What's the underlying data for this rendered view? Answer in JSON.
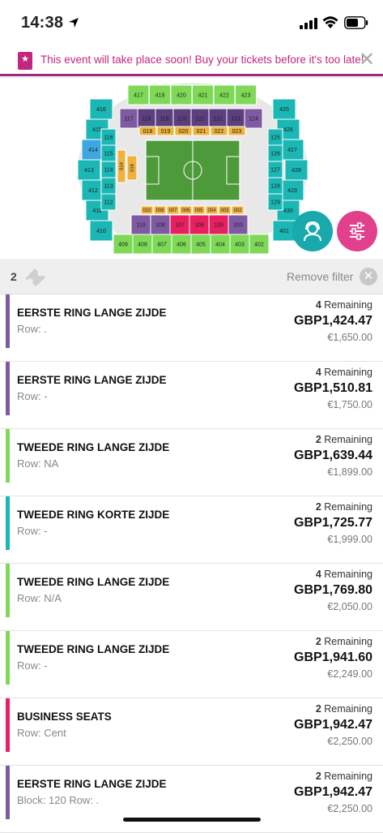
{
  "status": {
    "time": "14:38"
  },
  "banner": {
    "message": "This event will take place soon! Buy your tickets before it's too late!",
    "close": "✕"
  },
  "stadium": {
    "colors": {
      "purple": "#7e5aa3",
      "teal": "#1ab7b4",
      "green": "#7ed957",
      "blue": "#3ea6e0",
      "orange": "#f0b23e",
      "red": "#e8205f",
      "pitch": "#4d9a3a"
    },
    "labels": {
      "top_outer": [
        "417",
        "419",
        "420",
        "421",
        "422",
        "423"
      ],
      "top_inner": [
        "117",
        "118",
        "119",
        "120",
        "121",
        "122",
        "123",
        "124"
      ],
      "top_lower": [
        "018",
        "019",
        "020",
        "021",
        "022",
        "023"
      ],
      "bottom_lower": [
        "010",
        "008",
        "007",
        "006",
        "005",
        "004",
        "003",
        "002"
      ],
      "bottom_inner": [
        "110",
        "108",
        "107",
        "106",
        "105",
        "103"
      ],
      "bottom_outer": [
        "409",
        "408",
        "407",
        "406",
        "405",
        "404",
        "403",
        "402"
      ],
      "left": [
        "416",
        "415",
        "414",
        "413",
        "412",
        "411",
        "410",
        "116",
        "115",
        "114",
        "113",
        "112"
      ],
      "right": [
        "425",
        "426",
        "427",
        "428",
        "429",
        "430",
        "401",
        "125",
        "126",
        "127",
        "128",
        "129"
      ],
      "mid_left": [
        "014",
        "016"
      ]
    }
  },
  "filter": {
    "count": "2",
    "remove_label": "Remove filter",
    "remove_icon": "✕"
  },
  "listings": [
    {
      "title": "EERSTE RING LANGE ZIJDE",
      "sub": "Row: .",
      "remaining_count": "4",
      "remaining_label": " Remaining",
      "price": "GBP1,424.47",
      "eur": "€1,650.00",
      "color": "#7e5aa3"
    },
    {
      "title": "EERSTE RING LANGE ZIJDE",
      "sub": "Row: -",
      "remaining_count": "4",
      "remaining_label": " Remaining",
      "price": "GBP1,510.81",
      "eur": "€1,750.00",
      "color": "#7e5aa3"
    },
    {
      "title": "TWEEDE RING LANGE ZIJDE",
      "sub": "Row: NA",
      "remaining_count": "2",
      "remaining_label": " Remaining",
      "price": "GBP1,639.44",
      "eur": "€1,899.00",
      "color": "#7ed957"
    },
    {
      "title": "TWEEDE RING KORTE ZIJDE",
      "sub": "Row: -",
      "remaining_count": "2",
      "remaining_label": " Remaining",
      "price": "GBP1,725.77",
      "eur": "€1,999.00",
      "color": "#1ab7b4"
    },
    {
      "title": "TWEEDE RING LANGE ZIJDE",
      "sub": "Row: N/A",
      "remaining_count": "4",
      "remaining_label": " Remaining",
      "price": "GBP1,769.80",
      "eur": "€2,050.00",
      "color": "#7ed957"
    },
    {
      "title": "TWEEDE RING LANGE ZIJDE",
      "sub": "Row: -",
      "remaining_count": "2",
      "remaining_label": " Remaining",
      "price": "GBP1,941.60",
      "eur": "€2,249.00",
      "color": "#7ed957"
    },
    {
      "title": "BUSINESS SEATS",
      "sub": "Row: Cent",
      "remaining_count": "2",
      "remaining_label": " Remaining",
      "price": "GBP1,942.47",
      "eur": "€2,250.00",
      "color": "#e8205f"
    },
    {
      "title": "EERSTE RING LANGE ZIJDE",
      "sub": "Block: 120     Row: .",
      "remaining_count": "2",
      "remaining_label": " Remaining",
      "price": "GBP1,942.47",
      "eur": "€2,250.00",
      "color": "#7e5aa3"
    }
  ]
}
